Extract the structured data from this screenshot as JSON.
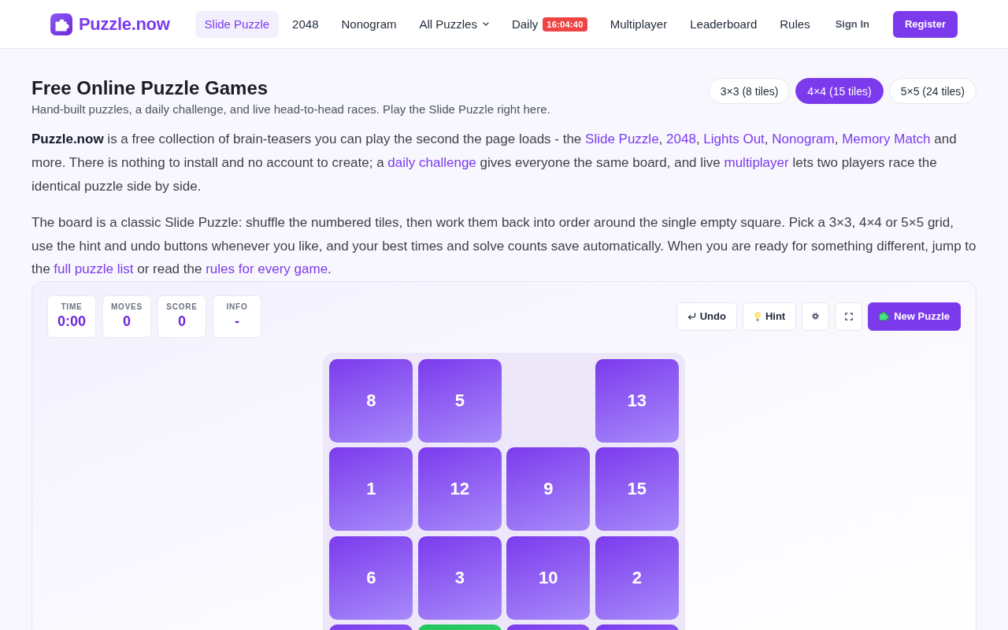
{
  "header": {
    "logo": "Puzzle.now",
    "nav": [
      {
        "label": "Slide Puzzle",
        "selected": true,
        "dropdown": false
      },
      {
        "label": "2048",
        "selected": false,
        "dropdown": false
      },
      {
        "label": "Nonogram",
        "selected": false,
        "dropdown": false
      },
      {
        "label": "All Puzzles",
        "selected": false,
        "dropdown": true
      },
      {
        "label": "Daily",
        "selected": false,
        "dropdown": false,
        "badge": "16:04:40"
      },
      {
        "label": "Multiplayer",
        "selected": false,
        "dropdown": false
      },
      {
        "label": "Leaderboard",
        "selected": false,
        "dropdown": false
      },
      {
        "label": "Rules",
        "selected": false,
        "dropdown": false
      }
    ],
    "sign_in": "Sign In",
    "register": "Register"
  },
  "intro": {
    "title": "Free Online Puzzle Games",
    "subtitle": "Hand-built puzzles, a daily challenge, and live head-to-head races. Play the Slide Puzzle right here.",
    "sizes": [
      {
        "label": "3×3 (8 tiles)",
        "selected": false
      },
      {
        "label": "4×4 (15 tiles)",
        "selected": true
      },
      {
        "label": "5×5 (24 tiles)",
        "selected": false
      }
    ],
    "paragraphs": [
      [
        {
          "kind": "text",
          "text": "**Puzzle.now** is a free collection of brain-teasers you can play the second the page loads - the "
        },
        {
          "kind": "link",
          "text": "Slide Puzzle"
        },
        {
          "kind": "text",
          "text": ", "
        },
        {
          "kind": "link",
          "text": "2048"
        },
        {
          "kind": "text",
          "text": ", "
        },
        {
          "kind": "link",
          "text": "Lights Out"
        },
        {
          "kind": "text",
          "text": ", "
        },
        {
          "kind": "link",
          "text": "Nonogram"
        },
        {
          "kind": "text",
          "text": ", "
        },
        {
          "kind": "link",
          "text": "Memory Match"
        },
        {
          "kind": "text",
          "text": " and more. There is nothing to install and no account to create; a "
        },
        {
          "kind": "link",
          "text": "daily challenge"
        },
        {
          "kind": "text",
          "text": " gives everyone the same board, and live "
        },
        {
          "kind": "link",
          "text": "multiplayer"
        },
        {
          "kind": "text",
          "text": " lets two players race the identical puzzle side by side."
        }
      ],
      [
        {
          "kind": "text",
          "text": "The board is a classic Slide Puzzle: shuffle the numbered tiles, then work them back into order around the single empty square. Pick a 3×3, 4×4 or 5×5 grid, use the hint and undo buttons whenever you like, and your best times and solve counts save automatically. When you are ready for something different, jump to the "
        },
        {
          "kind": "link",
          "text": "full puzzle list"
        },
        {
          "kind": "text",
          "text": " or read the "
        },
        {
          "kind": "link",
          "text": "rules for every game"
        },
        {
          "kind": "text",
          "text": "."
        }
      ]
    ]
  },
  "game": {
    "stats": [
      {
        "label": "TIME",
        "value": "0:00"
      },
      {
        "label": "MOVES",
        "value": "0"
      },
      {
        "label": "SCORE",
        "value": "0"
      },
      {
        "label": "INFO",
        "value": "-"
      }
    ],
    "buttons": [
      {
        "kind": "undo",
        "label": "Undo"
      },
      {
        "kind": "hint",
        "label": "Hint"
      },
      {
        "kind": "settings"
      },
      {
        "kind": "fullscreen"
      },
      {
        "kind": "new",
        "label": "New Puzzle"
      }
    ],
    "board": {
      "rows": [
        [
          {
            "kind": "tile",
            "number": "8",
            "highlighted": false
          },
          {
            "kind": "tile",
            "number": "5",
            "highlighted": false
          },
          {
            "kind": "empty"
          },
          {
            "kind": "tile",
            "number": "13",
            "highlighted": false
          }
        ],
        [
          {
            "kind": "tile",
            "number": "1",
            "highlighted": false
          },
          {
            "kind": "tile",
            "number": "12",
            "highlighted": false
          },
          {
            "kind": "tile",
            "number": "9",
            "highlighted": false
          },
          {
            "kind": "tile",
            "number": "15",
            "highlighted": false
          }
        ],
        [
          {
            "kind": "tile",
            "number": "6",
            "highlighted": false
          },
          {
            "kind": "tile",
            "number": "3",
            "highlighted": false
          },
          {
            "kind": "tile",
            "number": "10",
            "highlighted": false
          },
          {
            "kind": "tile",
            "number": "2",
            "highlighted": false
          }
        ],
        [
          {
            "kind": "tile",
            "highlighted": false
          },
          {
            "kind": "tile",
            "highlighted": true
          },
          {
            "kind": "tile",
            "highlighted": false
          },
          {
            "kind": "tile",
            "highlighted": false
          }
        ]
      ]
    }
  }
}
